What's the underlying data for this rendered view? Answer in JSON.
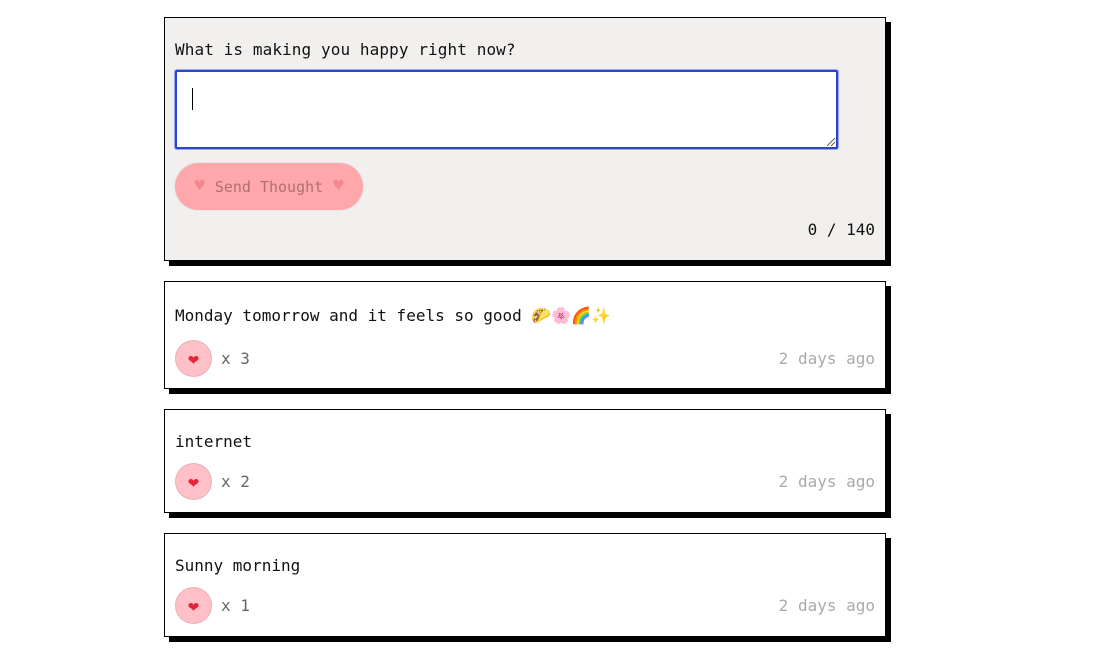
{
  "form": {
    "label": "What is making you happy right now?",
    "input_value": "",
    "input_placeholder": "",
    "send_label": "Send Thought",
    "heart_icon": "♥",
    "char_count": "0 / 140"
  },
  "thoughts": [
    {
      "text": "Monday tomorrow and it feels so good 🌮🌸🌈✨",
      "likes_label": "x 3",
      "time": "2 days ago",
      "heart_icon": "❤"
    },
    {
      "text": "internet",
      "likes_label": "x 2",
      "time": "2 days ago",
      "heart_icon": "❤"
    },
    {
      "text": "Sunny morning",
      "likes_label": "x 1",
      "time": "2 days ago",
      "heart_icon": "❤"
    }
  ],
  "colors": {
    "focus_border": "#2d43d6",
    "send_button_bg": "#ffa8ac",
    "like_button_bg": "#ffc0c8",
    "form_bg": "#f1f0ee"
  }
}
